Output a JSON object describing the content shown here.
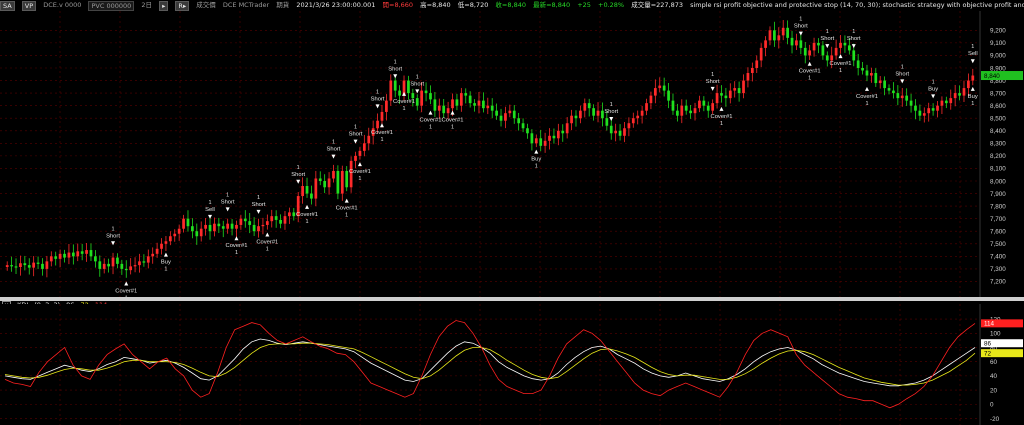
{
  "topbar": {
    "symbol_button": "SA",
    "flag_button": "VP",
    "contract": "DCE.v 0000",
    "pvc_box": "PVC 000000",
    "period": "2日",
    "period_menu": "▸",
    "exchange_menu": "R▸",
    "exchange_name": "成交價",
    "broker": "DCE MCTrader",
    "mode": "期貨",
    "datetime": "2021/3/26 23:00:00.001",
    "open_label": "開=8,660",
    "high_label": "高=8,840",
    "low_label": "低=8,720",
    "close_label": "收=8,840",
    "last_label": "最新=8,840",
    "change_label": "+25",
    "change_pct": "+0.28%",
    "volume_label": "成交量=227,873",
    "strategies": "simple rsi profit objective and protective stop (14, 70, 30); stochastic strategy with objective profit and protective stop (14, 3, 3)"
  },
  "kdj": {
    "close_label": "×",
    "name": "KDJ",
    "params": "(9, 3, 3)",
    "k_value": "86",
    "d_value": "72",
    "j_value": "114"
  },
  "colors": {
    "up": "#ff2a2a",
    "down": "#1fe01f",
    "k_line": "#ffffff",
    "d_line": "#e8e81a",
    "j_line": "#ff2020",
    "grid": "#5a0000",
    "axis_text": "#cfcfcf"
  },
  "chart_data": [
    {
      "type": "candlestick",
      "ylim": [
        7100,
        9330
      ],
      "yticks": [
        7200,
        7300,
        7400,
        7500,
        7600,
        7700,
        7800,
        7900,
        8000,
        8100,
        8200,
        8300,
        8400,
        8500,
        8600,
        8700,
        8800,
        8900,
        9000,
        9100,
        9200
      ],
      "ytick_labels": [
        "7,200",
        "7,300",
        "7,400",
        "7,500",
        "7,600",
        "7,700",
        "7,800",
        "7,900",
        "8,000",
        "8,100",
        "8,200",
        "8,300",
        "8,400",
        "8,500",
        "8,600",
        "8,700",
        "8,800",
        "8,900",
        "9,000",
        "9,100",
        "9,200"
      ],
      "last_price_label": "8,840",
      "closes": [
        7330,
        7320,
        7315,
        7345,
        7330,
        7310,
        7350,
        7340,
        7300,
        7360,
        7400,
        7380,
        7420,
        7390,
        7430,
        7400,
        7440,
        7420,
        7450,
        7400,
        7360,
        7300,
        7340,
        7320,
        7390,
        7340,
        7300,
        7290,
        7320,
        7330,
        7360,
        7350,
        7400,
        7420,
        7460,
        7500,
        7520,
        7560,
        7580,
        7620,
        7700,
        7640,
        7600,
        7560,
        7620,
        7650,
        7600,
        7660,
        7640,
        7620,
        7660,
        7620,
        7650,
        7700,
        7680,
        7650,
        7600,
        7640,
        7650,
        7680,
        7720,
        7690,
        7660,
        7720,
        7750,
        7720,
        7880,
        7960,
        7900,
        7860,
        8020,
        8000,
        7950,
        8020,
        8080,
        7900,
        8080,
        7950,
        8160,
        8200,
        8240,
        8300,
        8360,
        8420,
        8480,
        8550,
        8640,
        8800,
        8720,
        8680,
        8800,
        8700,
        8660,
        8600,
        8720,
        8700,
        8650,
        8560,
        8600,
        8540,
        8580,
        8650,
        8600,
        8700,
        8680,
        8620,
        8600,
        8640,
        8580,
        8600,
        8560,
        8520,
        8480,
        8540,
        8560,
        8500,
        8460,
        8420,
        8380,
        8300,
        8340,
        8280,
        8320,
        8360,
        8340,
        8400,
        8380,
        8460,
        8520,
        8500,
        8560,
        8620,
        8580,
        8520,
        8560,
        8500,
        8440,
        8380,
        8400,
        8360,
        8420,
        8460,
        8500,
        8520,
        8560,
        8620,
        8680,
        8740,
        8760,
        8720,
        8640,
        8560,
        8520,
        8600,
        8560,
        8540,
        8580,
        8640,
        8600,
        8560,
        8620,
        8700,
        8680,
        8660,
        8720,
        8740,
        8700,
        8800,
        8860,
        8900,
        8960,
        9060,
        9120,
        9200,
        9120,
        9160,
        9220,
        9140,
        9080,
        9120,
        9060,
        9000,
        9040,
        9100,
        9080,
        9000,
        8960,
        9000,
        9060,
        9100,
        9080,
        9040,
        8960,
        8900,
        8880,
        8840,
        8860,
        8780,
        8800,
        8740,
        8720,
        8700,
        8660,
        8680,
        8640,
        8600,
        8560,
        8520,
        8540,
        8580,
        8560,
        8600,
        8640,
        8620,
        8660,
        8700,
        8680,
        8740,
        8800,
        8840
      ],
      "signals": [
        {
          "bar": 24,
          "label": "Short",
          "count": "1",
          "pos": "above"
        },
        {
          "bar": 27,
          "label": "Cover#1",
          "count": "1",
          "pos": "below"
        },
        {
          "bar": 36,
          "label": "Buy",
          "count": "1",
          "pos": "below"
        },
        {
          "bar": 46,
          "label": "Sell",
          "count": "1",
          "pos": "above"
        },
        {
          "bar": 50,
          "label": "Short",
          "count": "1",
          "pos": "above"
        },
        {
          "bar": 52,
          "label": "Cover#1",
          "count": "1",
          "pos": "below"
        },
        {
          "bar": 57,
          "label": "Short",
          "count": "1",
          "pos": "above"
        },
        {
          "bar": 59,
          "label": "Cover#1",
          "count": "1",
          "pos": "below"
        },
        {
          "bar": 66,
          "label": "Short",
          "count": "1",
          "pos": "above"
        },
        {
          "bar": 68,
          "label": "Cover#1",
          "count": "1",
          "pos": "below"
        },
        {
          "bar": 74,
          "label": "Short",
          "count": "1",
          "pos": "above"
        },
        {
          "bar": 77,
          "label": "Cover#1",
          "count": "1",
          "pos": "below"
        },
        {
          "bar": 79,
          "label": "Short",
          "count": "1",
          "pos": "above"
        },
        {
          "bar": 80,
          "label": "Cover#1",
          "count": "1",
          "pos": "below"
        },
        {
          "bar": 84,
          "label": "Short",
          "count": "1",
          "pos": "above"
        },
        {
          "bar": 85,
          "label": "Cover#1",
          "count": "1",
          "pos": "below"
        },
        {
          "bar": 88,
          "label": "Short",
          "count": "1",
          "pos": "above"
        },
        {
          "bar": 90,
          "label": "Cover#1",
          "count": "1",
          "pos": "below"
        },
        {
          "bar": 93,
          "label": "Short",
          "count": "1",
          "pos": "above"
        },
        {
          "bar": 96,
          "label": "Cover#1",
          "count": "1",
          "pos": "below"
        },
        {
          "bar": 101,
          "label": "Cover#1",
          "count": "1",
          "pos": "below"
        },
        {
          "bar": 120,
          "label": "Buy",
          "count": "1",
          "pos": "below"
        },
        {
          "bar": 137,
          "label": "Short",
          "count": "1",
          "pos": "above"
        },
        {
          "bar": 160,
          "label": "Short",
          "count": "1",
          "pos": "above"
        },
        {
          "bar": 162,
          "label": "Cover#1",
          "count": "1",
          "pos": "below"
        },
        {
          "bar": 180,
          "label": "Short",
          "count": "1",
          "pos": "above"
        },
        {
          "bar": 182,
          "label": "Cover#1",
          "count": "1",
          "pos": "below"
        },
        {
          "bar": 186,
          "label": "Short",
          "count": "1",
          "pos": "above"
        },
        {
          "bar": 189,
          "label": "Cover#1",
          "count": "1",
          "pos": "below"
        },
        {
          "bar": 192,
          "label": "Short",
          "count": "1",
          "pos": "above"
        },
        {
          "bar": 195,
          "label": "Cover#1",
          "count": "1",
          "pos": "below"
        },
        {
          "bar": 203,
          "label": "Short",
          "count": "1",
          "pos": "above"
        },
        {
          "bar": 210,
          "label": "Buy",
          "count": "1",
          "pos": "above"
        },
        {
          "bar": 225,
          "label": "Sell",
          "count": "1",
          "pos": "above"
        },
        {
          "bar": 226,
          "label": "Buy",
          "count": "1",
          "pos": "below"
        }
      ]
    },
    {
      "type": "line",
      "title": "KDJ",
      "ylim": [
        -25,
        130
      ],
      "yticks": [
        -20,
        0,
        20,
        40,
        60,
        80,
        100,
        120
      ],
      "ytick_labels": [
        "-20",
        "0",
        "20",
        "40",
        "60",
        "80",
        "100",
        "120"
      ],
      "value_tags": [
        "114",
        "86",
        "72"
      ],
      "series": [
        {
          "name": "K",
          "values": [
            40,
            38,
            36,
            35,
            40,
            45,
            50,
            55,
            52,
            48,
            46,
            50,
            56,
            60,
            66,
            64,
            62,
            58,
            60,
            62,
            58,
            52,
            44,
            36,
            34,
            40,
            52,
            64,
            78,
            88,
            92,
            90,
            86,
            84,
            86,
            88,
            86,
            84,
            82,
            80,
            78,
            74,
            66,
            58,
            52,
            46,
            40,
            34,
            32,
            36,
            48,
            60,
            72,
            82,
            88,
            86,
            80,
            72,
            60,
            52,
            46,
            40,
            36,
            34,
            36,
            44,
            56,
            66,
            74,
            80,
            82,
            78,
            70,
            64,
            58,
            50,
            44,
            40,
            38,
            40,
            44,
            40,
            36,
            34,
            32,
            36,
            42,
            50,
            60,
            68,
            74,
            78,
            80,
            76,
            70,
            64,
            56,
            50,
            44,
            40,
            36,
            32,
            30,
            28,
            26,
            26,
            28,
            30,
            34,
            40,
            48,
            56,
            64,
            72,
            80
          ]
        },
        {
          "name": "D",
          "values": [
            42,
            40,
            38,
            37,
            38,
            41,
            45,
            49,
            51,
            50,
            48,
            48,
            51,
            55,
            60,
            62,
            62,
            60,
            60,
            60,
            59,
            56,
            51,
            45,
            40,
            39,
            44,
            52,
            62,
            72,
            80,
            84,
            85,
            85,
            85,
            86,
            86,
            85,
            84,
            82,
            80,
            78,
            73,
            67,
            61,
            55,
            49,
            43,
            38,
            36,
            40,
            48,
            58,
            68,
            76,
            80,
            80,
            77,
            70,
            62,
            55,
            48,
            42,
            38,
            36,
            38,
            46,
            55,
            64,
            72,
            77,
            78,
            75,
            71,
            66,
            59,
            52,
            46,
            42,
            40,
            41,
            41,
            39,
            37,
            35,
            35,
            38,
            43,
            50,
            58,
            65,
            71,
            75,
            76,
            74,
            70,
            64,
            58,
            52,
            47,
            42,
            37,
            34,
            31,
            29,
            27,
            27,
            28,
            30,
            34,
            40,
            46,
            54,
            62,
            72
          ]
        },
        {
          "name": "J",
          "values": [
            35,
            30,
            28,
            25,
            45,
            60,
            70,
            80,
            55,
            40,
            35,
            55,
            70,
            78,
            85,
            70,
            60,
            50,
            60,
            65,
            50,
            40,
            20,
            10,
            15,
            45,
            80,
            105,
            110,
            115,
            112,
            100,
            90,
            85,
            90,
            95,
            88,
            82,
            78,
            72,
            70,
            60,
            45,
            30,
            25,
            20,
            15,
            10,
            15,
            40,
            70,
            95,
            110,
            118,
            115,
            100,
            80,
            55,
            35,
            25,
            20,
            15,
            15,
            20,
            40,
            65,
            85,
            95,
            105,
            100,
            90,
            75,
            60,
            45,
            30,
            20,
            15,
            12,
            20,
            25,
            30,
            25,
            20,
            15,
            10,
            25,
            45,
            70,
            90,
            100,
            105,
            100,
            95,
            70,
            55,
            45,
            35,
            25,
            15,
            10,
            8,
            5,
            5,
            0,
            -5,
            0,
            8,
            15,
            25,
            40,
            60,
            80,
            95,
            105,
            114
          ]
        }
      ]
    }
  ]
}
